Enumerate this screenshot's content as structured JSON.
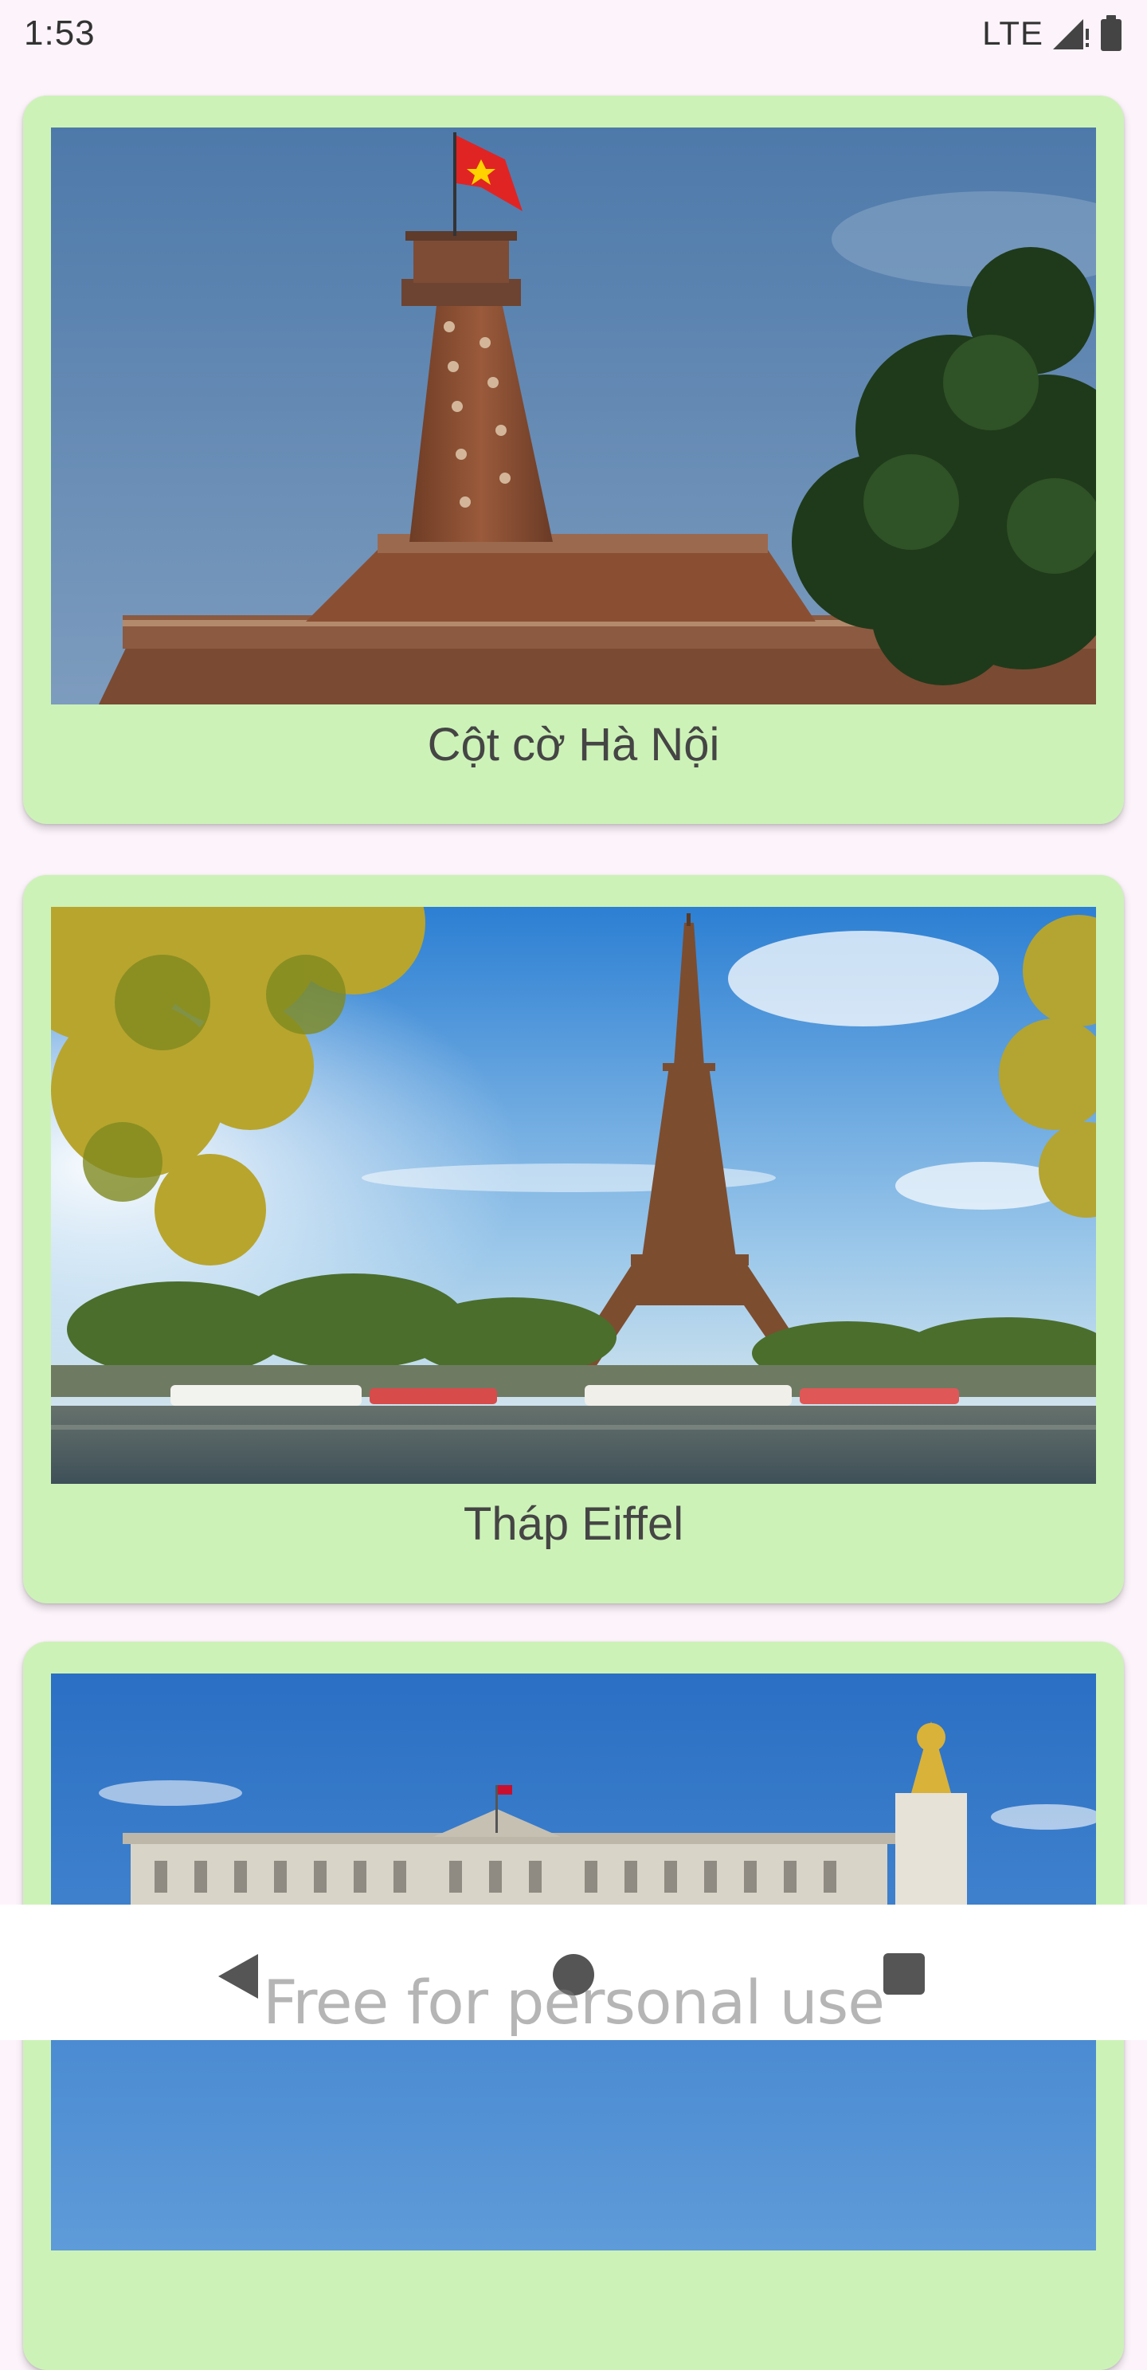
{
  "status_bar": {
    "time": "1:53",
    "network": "LTE",
    "signal_icon": "signal-no-data-icon",
    "battery_icon": "battery-full-icon"
  },
  "places": [
    {
      "title": "Cột cờ Hà Nội",
      "image": "hanoi-flag-tower-photo"
    },
    {
      "title": "Tháp Eiffel",
      "image": "eiffel-tower-photo"
    },
    {
      "title": "",
      "image": "buckingham-palace-photo"
    }
  ],
  "nav_bar": {
    "back_icon": "back-icon",
    "home_icon": "home-icon",
    "recents_icon": "recents-icon"
  },
  "watermark": "Free for personal use",
  "colors": {
    "background": "#fdf4fb",
    "card": "#cdf2b8",
    "title_text": "#454545"
  }
}
